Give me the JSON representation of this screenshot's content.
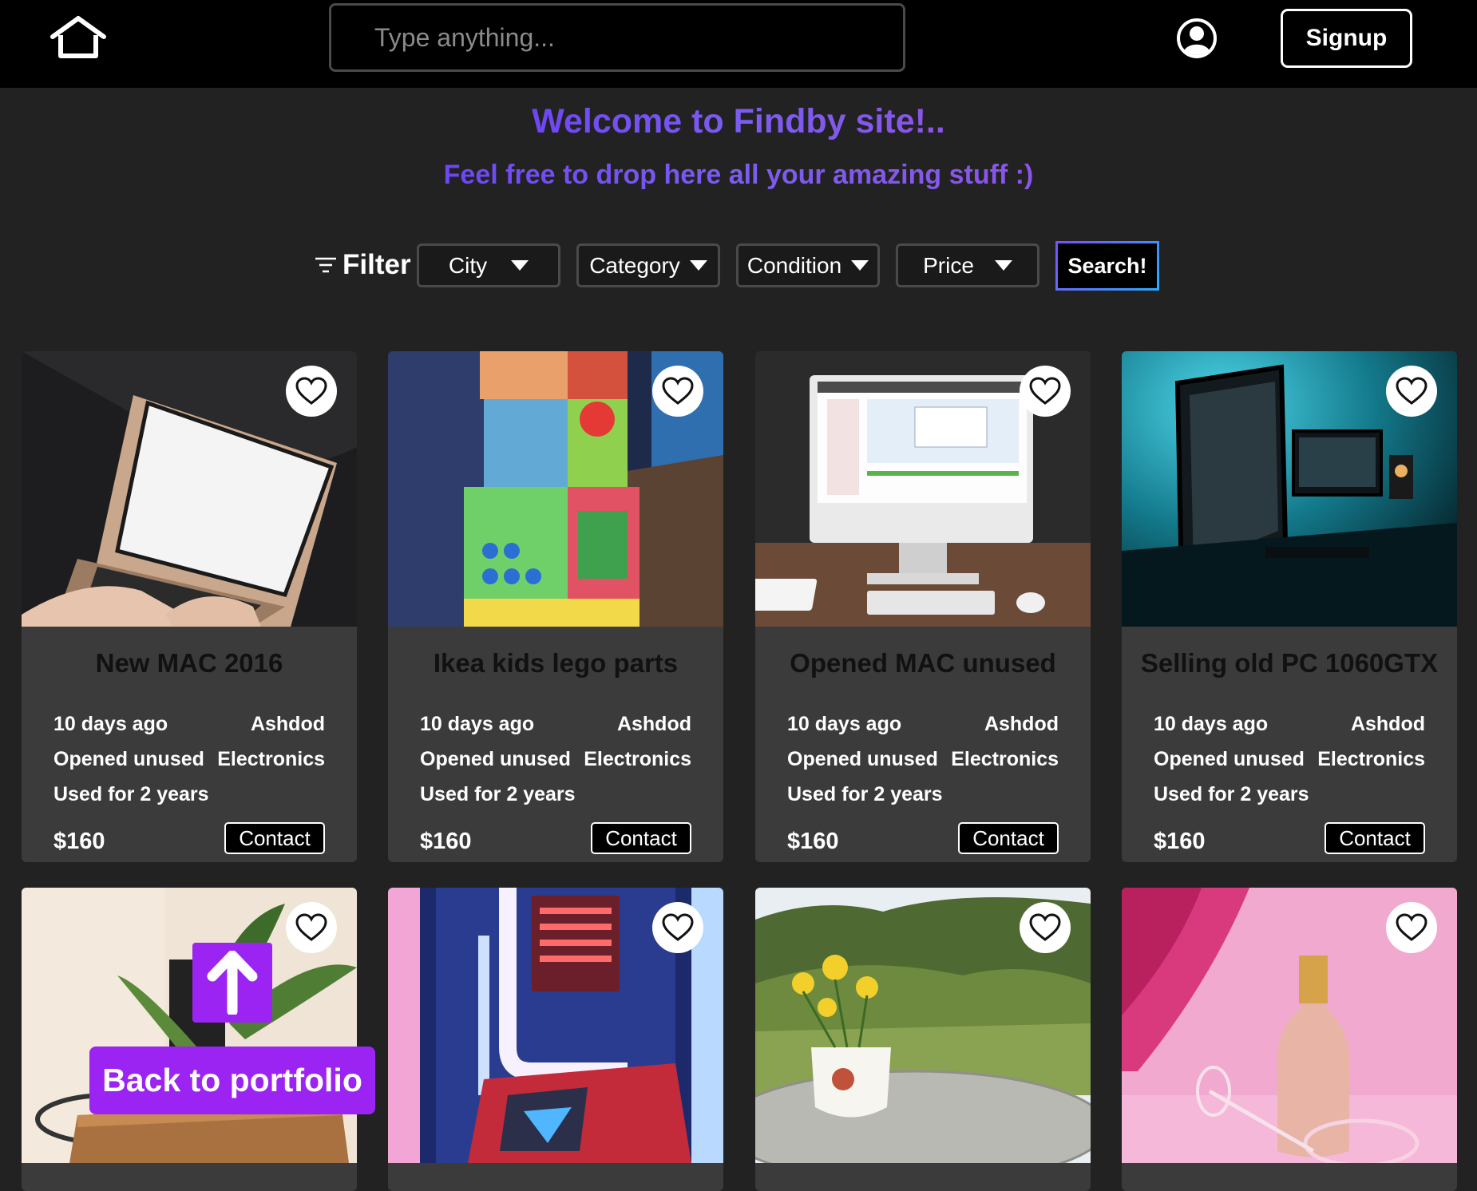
{
  "header": {
    "search_placeholder": "Type anything...",
    "signup_label": "Signup",
    "icons": {
      "home": "home-icon",
      "user": "user-circle-icon"
    }
  },
  "hero": {
    "title": "Welcome to Findby site!..",
    "subtitle": "Feel free to drop here all your amazing stuff :)"
  },
  "filters": {
    "label": "Filter",
    "city": "City",
    "category": "Category",
    "condition": "Condition",
    "price": "Price",
    "search_label": "Search!"
  },
  "cards": [
    {
      "title": "New MAC 2016",
      "posted": "10 days ago",
      "city": "Ashdod",
      "condition": "Opened unused",
      "category": "Electronics",
      "usage": "Used for 2 years",
      "price": "$160",
      "contact_label": "Contact",
      "image": "laptop-photo"
    },
    {
      "title": "Ikea kids lego parts",
      "posted": "10 days ago",
      "city": "Ashdod",
      "condition": "Opened unused",
      "category": "Electronics",
      "usage": "Used for 2 years",
      "price": "$160",
      "contact_label": "Contact",
      "image": "toy-blocks-photo"
    },
    {
      "title": "Opened MAC unused",
      "posted": "10 days ago",
      "city": "Ashdod",
      "condition": "Opened unused",
      "category": "Electronics",
      "usage": "Used for 2 years",
      "price": "$160",
      "contact_label": "Contact",
      "image": "imac-photo"
    },
    {
      "title": "Selling old PC 1060GTX",
      "posted": "10 days ago",
      "city": "Ashdod",
      "condition": "Opened unused",
      "category": "Electronics",
      "usage": "Used for 2 years",
      "price": "$160",
      "contact_label": "Contact",
      "image": "pc-setup-photo"
    },
    {
      "image": "table-plant-photo"
    },
    {
      "image": "gaming-pc-internals-photo"
    },
    {
      "image": "flower-vase-photo"
    },
    {
      "image": "champagne-photo"
    }
  ],
  "portfolio": {
    "label": "Back to portfolio",
    "icon": "arrow-up-icon"
  },
  "colors": {
    "accent": "#9b24f2",
    "gradient_start": "#6e46f5",
    "card_bg": "#3b3b3b",
    "page_bg": "#222222"
  }
}
